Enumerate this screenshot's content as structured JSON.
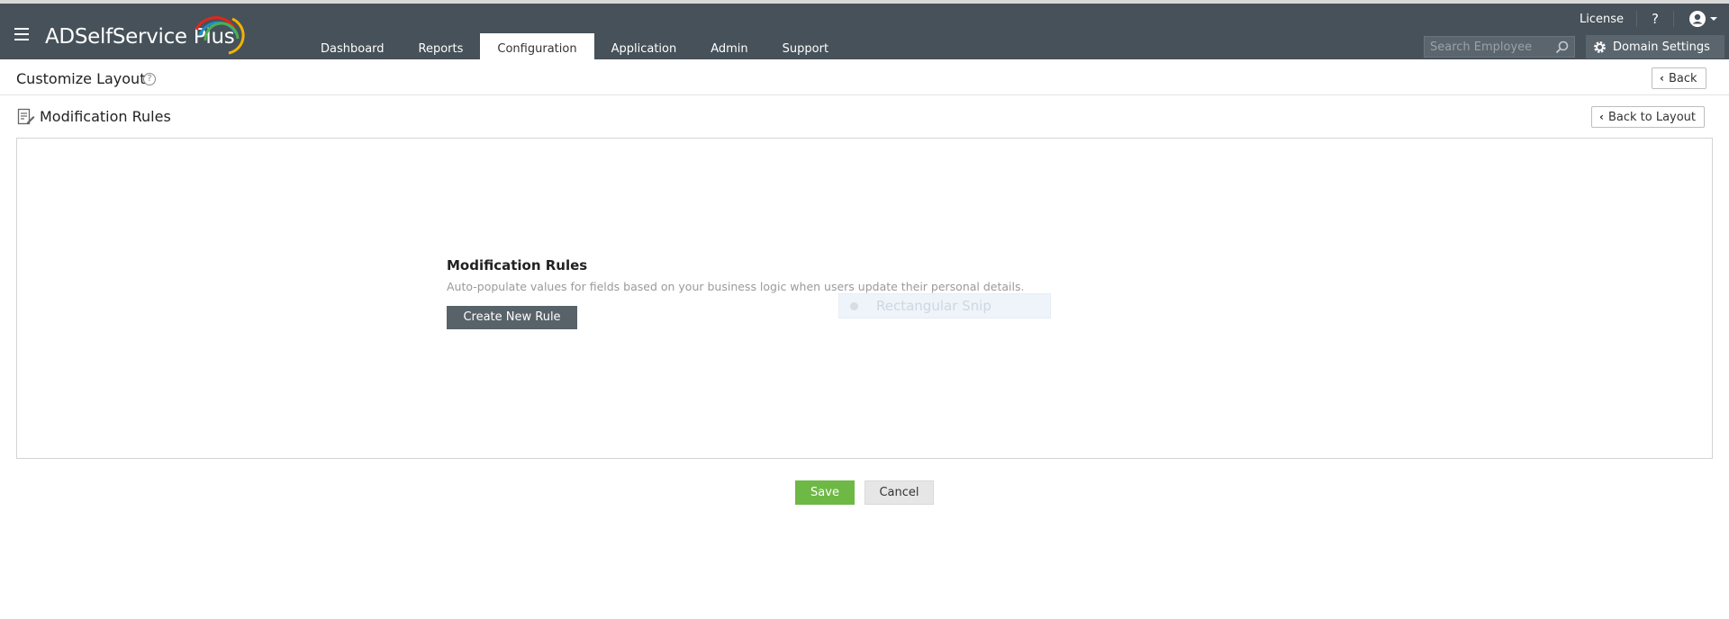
{
  "app": {
    "name": "ADSelfService Plus",
    "logo_main": "ADSelfService",
    "logo_plus": " Plus"
  },
  "nav": {
    "tabs": [
      {
        "label": "Dashboard",
        "active": false
      },
      {
        "label": "Reports",
        "active": false
      },
      {
        "label": "Configuration",
        "active": true
      },
      {
        "label": "Application",
        "active": false
      },
      {
        "label": "Admin",
        "active": false
      },
      {
        "label": "Support",
        "active": false
      }
    ]
  },
  "topbar": {
    "license": "License",
    "help": "?",
    "search_placeholder": "Search Employee",
    "domain_settings": "Domain Settings"
  },
  "page": {
    "title": "Customize Layout",
    "back_label": "Back"
  },
  "section": {
    "title": "Modification Rules",
    "back_to_layout_label": "Back to Layout"
  },
  "panel": {
    "heading": "Modification Rules",
    "description": "Auto-populate values for fields based on your business logic when users update their personal details.",
    "create_button": "Create New Rule",
    "snip_overlay": "Rectangular Snip"
  },
  "footer": {
    "save": "Save",
    "cancel": "Cancel"
  },
  "colors": {
    "header_bg": "#465159",
    "save_green": "#6eb845",
    "create_btn_bg": "#586269"
  }
}
